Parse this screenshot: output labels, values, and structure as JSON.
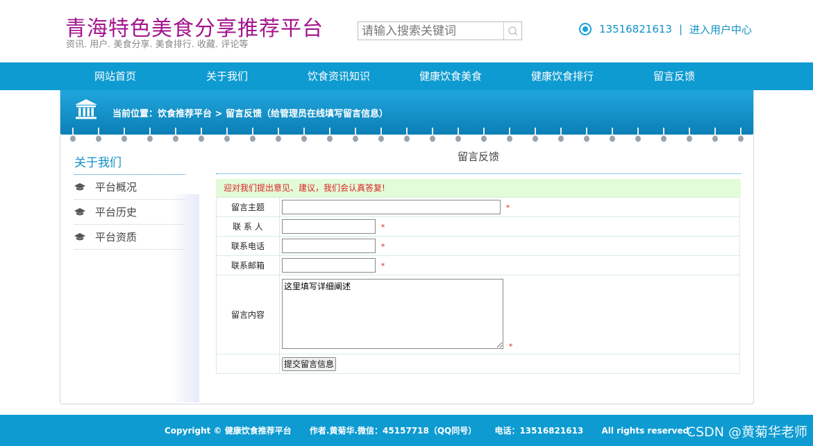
{
  "header": {
    "site_title": "青海特色美食分享推荐平台",
    "site_subtitle": "资讯. 用户. 美食分享. 美食排行. 收藏. 评论等",
    "search_placeholder": "请输入搜索关键词",
    "phone": "13516821613",
    "separator": "|",
    "user_center": "进入用户中心"
  },
  "nav": {
    "items": [
      {
        "label": "网站首页"
      },
      {
        "label": "关于我们"
      },
      {
        "label": "饮食资讯知识"
      },
      {
        "label": "健康饮食美食"
      },
      {
        "label": "健康饮食排行"
      },
      {
        "label": "留言反馈"
      }
    ]
  },
  "breadcrumb": {
    "text": "当前位置：饮食推荐平台 > 留言反馈（给管理员在线填写留言信息）"
  },
  "sidebar": {
    "title": "关于我们",
    "items": [
      {
        "label": "平台概况"
      },
      {
        "label": "平台历史"
      },
      {
        "label": "平台资质"
      }
    ]
  },
  "main": {
    "title": "留言反馈",
    "notice": "迎对我们提出意见、建议，我们会认真答复!",
    "form": {
      "subject_label": "留言主题",
      "contact_label": "联 系 人",
      "phone_label": "联系电话",
      "email_label": "联系邮箱",
      "content_label": "留言内容",
      "content_value": "这里填写详细阐述",
      "required_mark": "*",
      "submit_label": "提交留言信息"
    }
  },
  "footer": {
    "copyright": "Copyright © 健康饮食推荐平台",
    "author": "作者.黄菊华.微信：45157718（QQ同号）",
    "phone": "电话：13516821613",
    "rights": "All rights reserved.",
    "watermark": "CSDN @黄菊华老师"
  },
  "colors": {
    "title": "#a3148e",
    "accent": "#0e9bd1",
    "link": "#1191c7",
    "notice_bg": "#e2fcd9",
    "required": "#dd2222"
  }
}
